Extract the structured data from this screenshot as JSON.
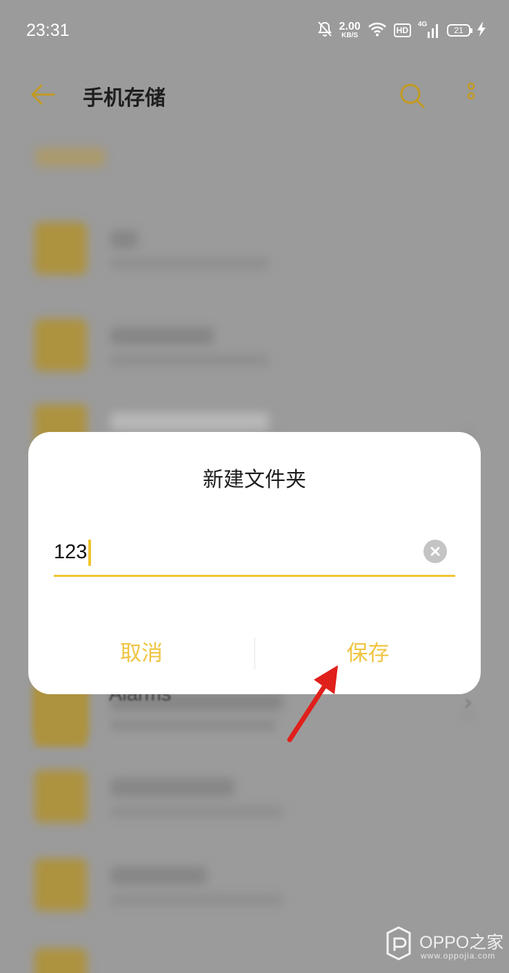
{
  "status_bar": {
    "time": "23:31",
    "net_speed_value": "2.00",
    "net_speed_unit": "KB/S",
    "hd_label": "HD",
    "network_label": "4G",
    "battery_level": "21"
  },
  "header": {
    "title": "手机存储",
    "accent_color": "#c39a1f"
  },
  "background_rows": [
    {
      "name": ""
    },
    {
      "name": ""
    },
    {
      "name": ""
    },
    {
      "name": "Alarms"
    },
    {
      "name": ""
    },
    {
      "name": ""
    }
  ],
  "dialog": {
    "title": "新建文件夹",
    "field_value": "123",
    "cancel_label": "取消",
    "save_label": "保存",
    "button_color": "#efc542"
  },
  "watermark": {
    "brand": "OPPO之家",
    "url": "www.oppojia.com"
  }
}
